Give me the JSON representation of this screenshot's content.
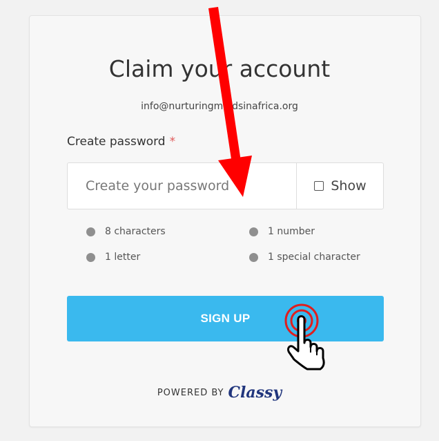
{
  "form": {
    "title": "Claim your account",
    "email": "info@nurturingmindsinafrica.org",
    "password_label": "Create password",
    "required_mark": "*",
    "password_placeholder": "Create your password",
    "show_label": "Show",
    "requirements": [
      "8 characters",
      "1 number",
      "1 letter",
      "1 special character"
    ],
    "signup_label": "SIGN UP"
  },
  "footer": {
    "powered_by": "POWERED BY",
    "brand": "Classy"
  },
  "colors": {
    "accent": "#3ab9ee",
    "brand": "#21367d",
    "required": "#e05a5a",
    "annotation_arrow": "#ff0000"
  },
  "annotations": {
    "arrow_icon": "red-arrow-icon",
    "cursor_icon": "hand-pointer-icon"
  }
}
